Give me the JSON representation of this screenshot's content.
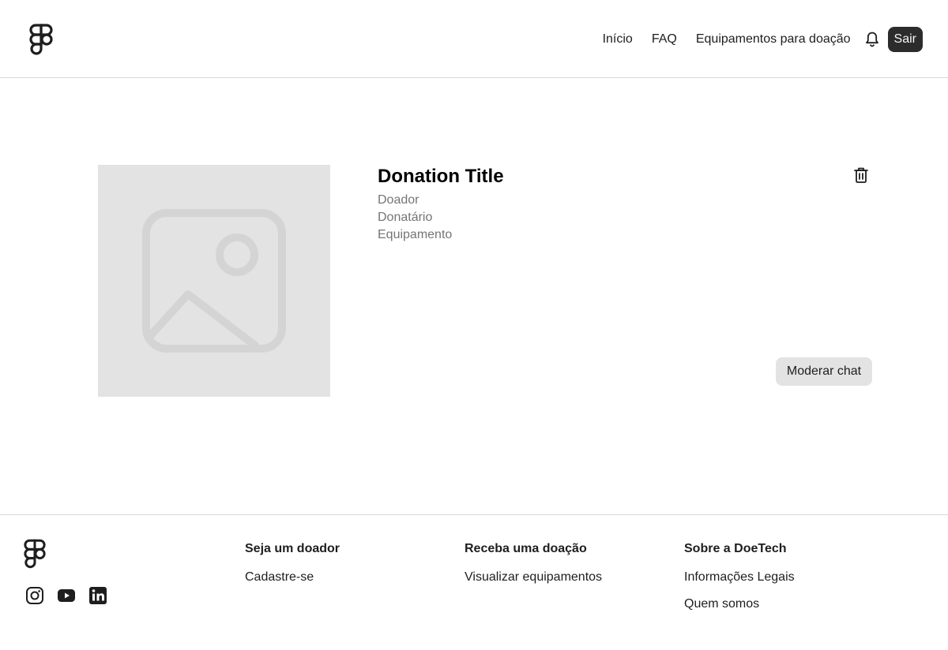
{
  "header": {
    "logo_icon": "figma-logo-icon",
    "nav": [
      {
        "label": "Início"
      },
      {
        "label": "FAQ"
      },
      {
        "label": "Equipamentos para doação"
      }
    ],
    "notification_icon": "bell-icon",
    "signout_label": "Sair"
  },
  "donation": {
    "image_icon": "image-placeholder-icon",
    "title": "Donation Title",
    "donor_label": "Doador",
    "recipient_label": "Donatário",
    "equipment_label": "Equipamento",
    "delete_icon": "trash-icon",
    "moderate_chat_label": "Moderar chat"
  },
  "footer": {
    "logo_icon": "figma-logo-icon",
    "socials": [
      "instagram-icon",
      "youtube-icon",
      "linkedin-icon"
    ],
    "columns": [
      {
        "title": "Seja um doador",
        "links": [
          "Cadastre-se"
        ]
      },
      {
        "title": "Receba uma doação",
        "links": [
          "Visualizar equipamentos"
        ]
      },
      {
        "title": "Sobre a DoeTech",
        "links": [
          "Informações Legais",
          "Quem somos"
        ]
      }
    ]
  },
  "colors": {
    "dark_button": "#2c2c2c",
    "light_button": "#e3e3e3",
    "muted_text": "#757575",
    "border": "#d9d9d9"
  }
}
